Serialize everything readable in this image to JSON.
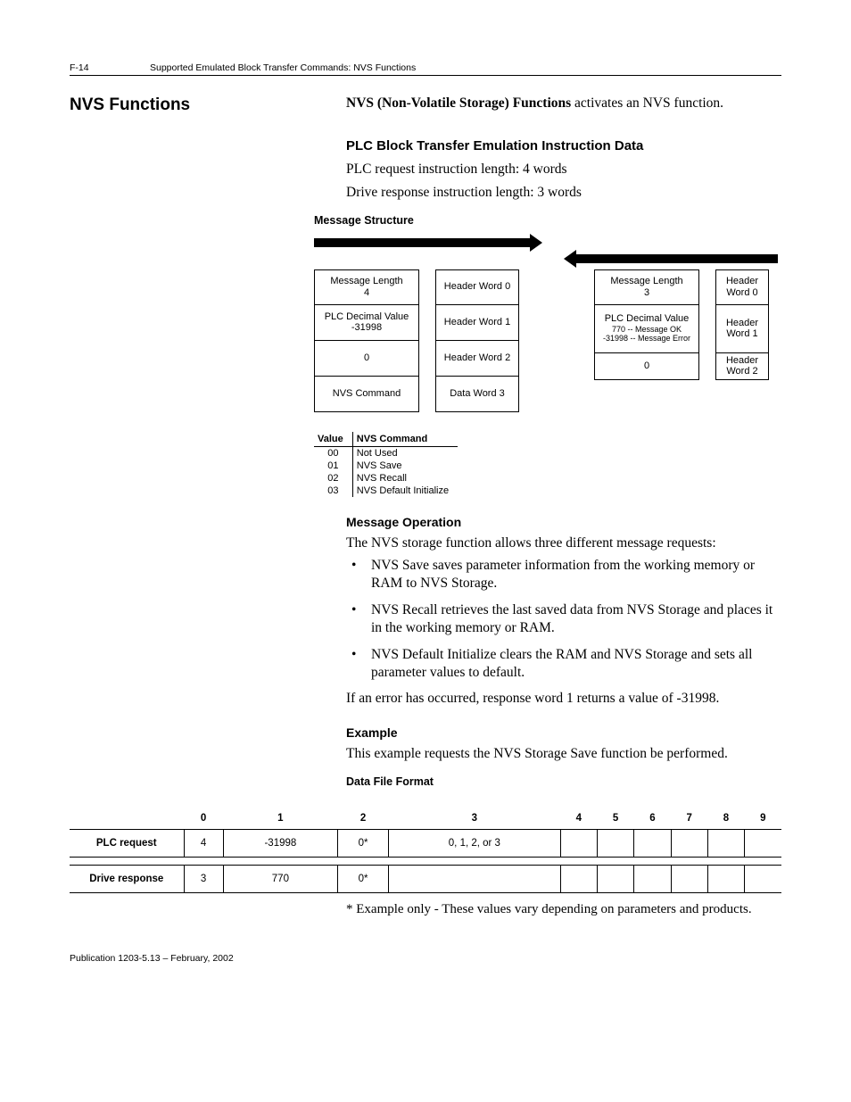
{
  "header": {
    "pagenum": "F-14",
    "title": "Supported Emulated Block Transfer Commands: NVS Functions"
  },
  "section": {
    "left_heading": "NVS Functions",
    "intro_bold": "NVS (Non-Volatile Storage) Functions",
    "intro_rest": " activates an NVS function.",
    "plc_heading": "PLC Block Transfer Emulation Instruction Data",
    "plc_line1": "PLC request instruction length: 4 words",
    "plc_line2": "Drive response instruction length: 3 words",
    "msg_struct_heading": "Message Structure"
  },
  "diag": {
    "left_stack": [
      [
        "Message Length",
        "4"
      ],
      [
        "PLC Decimal Value",
        "-31998"
      ],
      [
        "0",
        ""
      ],
      [
        "NVS Command",
        ""
      ]
    ],
    "left_labels": [
      "Header Word 0",
      "Header Word 1",
      "Header Word 2",
      "Data Word 3"
    ],
    "right_stack": [
      [
        "Message Length",
        "3"
      ],
      [
        "PLC Decimal Value",
        "770 -- Message OK",
        "-31998 -- Message Error"
      ],
      [
        "0",
        ""
      ]
    ],
    "right_labels": [
      "Header Word 0",
      "Header Word 1",
      "Header Word 2"
    ]
  },
  "nvs_cmd_table": {
    "headers": [
      "Value",
      "NVS Command"
    ],
    "rows": [
      [
        "00",
        "Not Used"
      ],
      [
        "01",
        "NVS Save"
      ],
      [
        "02",
        "NVS Recall"
      ],
      [
        "03",
        "NVS Default Initialize"
      ]
    ]
  },
  "msg_op": {
    "heading": "Message Operation",
    "intro": "The NVS storage function allows three different message requests:",
    "bullets": [
      "NVS Save saves parameter information from the working memory or RAM to NVS Storage.",
      "NVS Recall retrieves the last saved data from NVS Storage and places it in the working memory or RAM.",
      "NVS Default Initialize clears the RAM and NVS Storage and sets all parameter values to default."
    ],
    "error_line": "If an error has occurred, response word 1 returns a value of -31998."
  },
  "example": {
    "heading": "Example",
    "line": "This example requests the NVS Storage Save function be performed.",
    "dff_heading": "Data File Format"
  },
  "dff_table": {
    "cols": [
      "0",
      "1",
      "2",
      "3",
      "4",
      "5",
      "6",
      "7",
      "8",
      "9"
    ],
    "rows": [
      {
        "label": "PLC request",
        "cells": [
          "4",
          "-31998",
          "0*",
          "0, 1, 2, or 3",
          "",
          "",
          "",
          "",
          "",
          ""
        ]
      },
      {
        "label": "Drive response",
        "cells": [
          "3",
          "770",
          "0*",
          "",
          "",
          "",
          "",
          "",
          "",
          ""
        ]
      }
    ]
  },
  "footnote": "* Example only - These values vary depending on parameters and products.",
  "chart_data": {
    "type": "table",
    "title": "Data File Format",
    "columns": [
      "0",
      "1",
      "2",
      "3",
      "4",
      "5",
      "6",
      "7",
      "8",
      "9"
    ],
    "rows": {
      "PLC request": [
        "4",
        "-31998",
        "0*",
        "0, 1, 2, or 3",
        "",
        "",
        "",
        "",
        "",
        ""
      ],
      "Drive response": [
        "3",
        "770",
        "0*",
        "",
        "",
        "",
        "",
        "",
        "",
        ""
      ]
    }
  },
  "pubfoot": "Publication 1203-5.13 – February, 2002"
}
